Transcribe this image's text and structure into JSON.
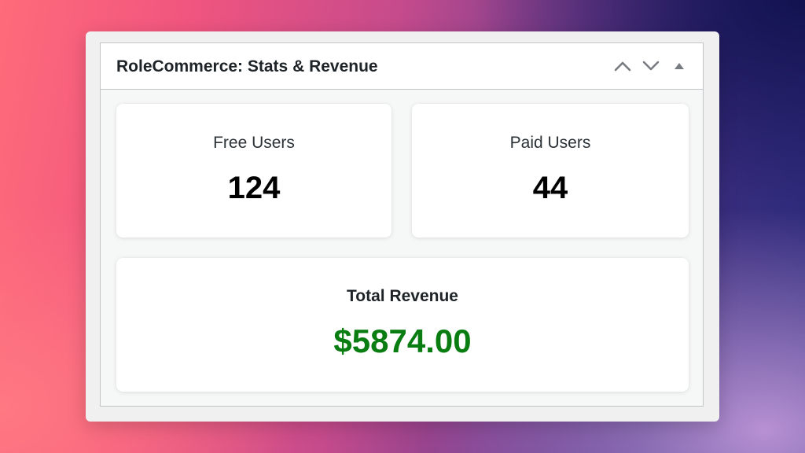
{
  "widget": {
    "title": "RoleCommerce: Stats & Revenue",
    "controls": {
      "move_up_icon": "chevron-up-icon",
      "move_down_icon": "chevron-down-icon",
      "toggle_icon": "triangle-up-icon"
    }
  },
  "stats": {
    "free_users": {
      "label": "Free Users",
      "value": "124"
    },
    "paid_users": {
      "label": "Paid Users",
      "value": "44"
    },
    "total_revenue": {
      "label": "Total Revenue",
      "value": "$5874.00"
    }
  },
  "colors": {
    "revenue_value": "#0a7d12",
    "handle_icon": "#787c82",
    "title_text": "#1d2327"
  }
}
